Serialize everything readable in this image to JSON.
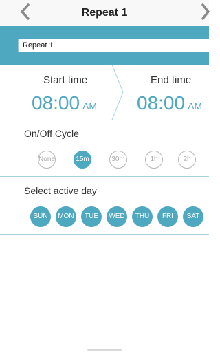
{
  "nav": {
    "title": "Repeat 1"
  },
  "schedule": {
    "name_value": "Repeat 1"
  },
  "time": {
    "start_label": "Start time",
    "start_time": "08:00",
    "start_ampm": "AM",
    "end_label": "End time",
    "end_time": "08:00",
    "end_ampm": "AM"
  },
  "cycle": {
    "label": "On/Off Cycle",
    "options": [
      "None",
      "15m",
      "30m",
      "1h",
      "2h"
    ],
    "selected": "15m"
  },
  "days": {
    "label": "Select active day",
    "items": [
      "SUN",
      "MON",
      "TUE",
      "WED",
      "THU",
      "FRI",
      "SAT"
    ]
  },
  "colors": {
    "accent": "#4da8c0",
    "separator": "#a6d1dd",
    "nav_bg": "#f8f8f8"
  },
  "icons": {
    "back": "chevron-left-icon",
    "next": "chevron-right-icon"
  }
}
